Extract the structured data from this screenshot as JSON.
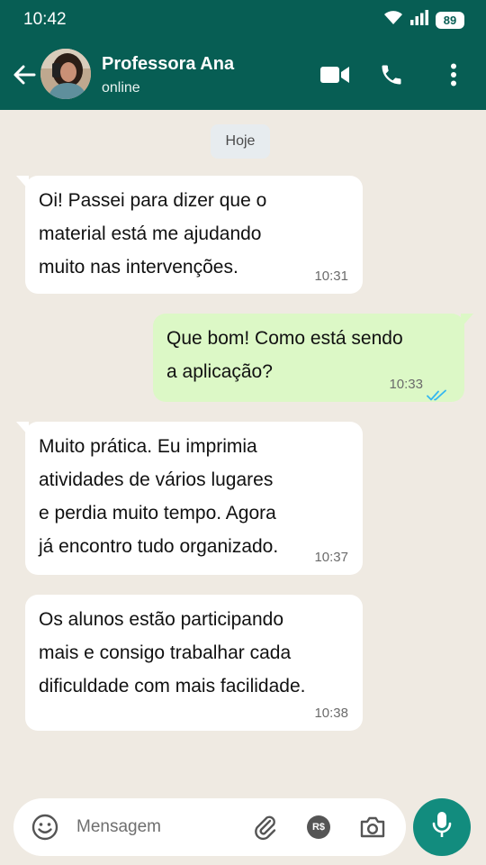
{
  "status_bar": {
    "time": "10:42",
    "battery": "89"
  },
  "header": {
    "contact_name": "Professora Ana",
    "contact_status": "online",
    "icons": [
      "back-arrow-icon",
      "video-call-icon",
      "phone-icon",
      "more-vert-icon"
    ]
  },
  "chat": {
    "date_divider": "Hoje",
    "messages": [
      {
        "direction": "incoming",
        "text": "Oi! Passei para dizer que o\nmaterial está me ajudando\nmuito nas intervenções.",
        "time": "10:31"
      },
      {
        "direction": "outgoing",
        "text": "Que bom! Como está sendo\na aplicação?",
        "time": "10:33",
        "status": "read"
      },
      {
        "direction": "incoming",
        "text": "Muito prática. Eu imprimia\natividades de vários lugares\ne perdia muito tempo. Agora\njá encontro tudo organizado.",
        "time": "10:37"
      },
      {
        "direction": "incoming",
        "text": "Os alunos estão participando\nmais e consigo trabalhar cada\ndificuldade com mais facilidade.",
        "time": "10:38"
      }
    ]
  },
  "composer": {
    "placeholder": "Mensagem",
    "payment_label": "R$",
    "icons": [
      "emoji-icon",
      "attach-icon",
      "payment-icon",
      "camera-icon",
      "mic-icon"
    ]
  },
  "colors": {
    "header": "#075e54",
    "chat_background": "#efeae2",
    "incoming_bubble": "#ffffff",
    "outgoing_bubble": "#dcf8c6",
    "read_ticks": "#34b7f1",
    "mic_button": "#128c7e"
  }
}
